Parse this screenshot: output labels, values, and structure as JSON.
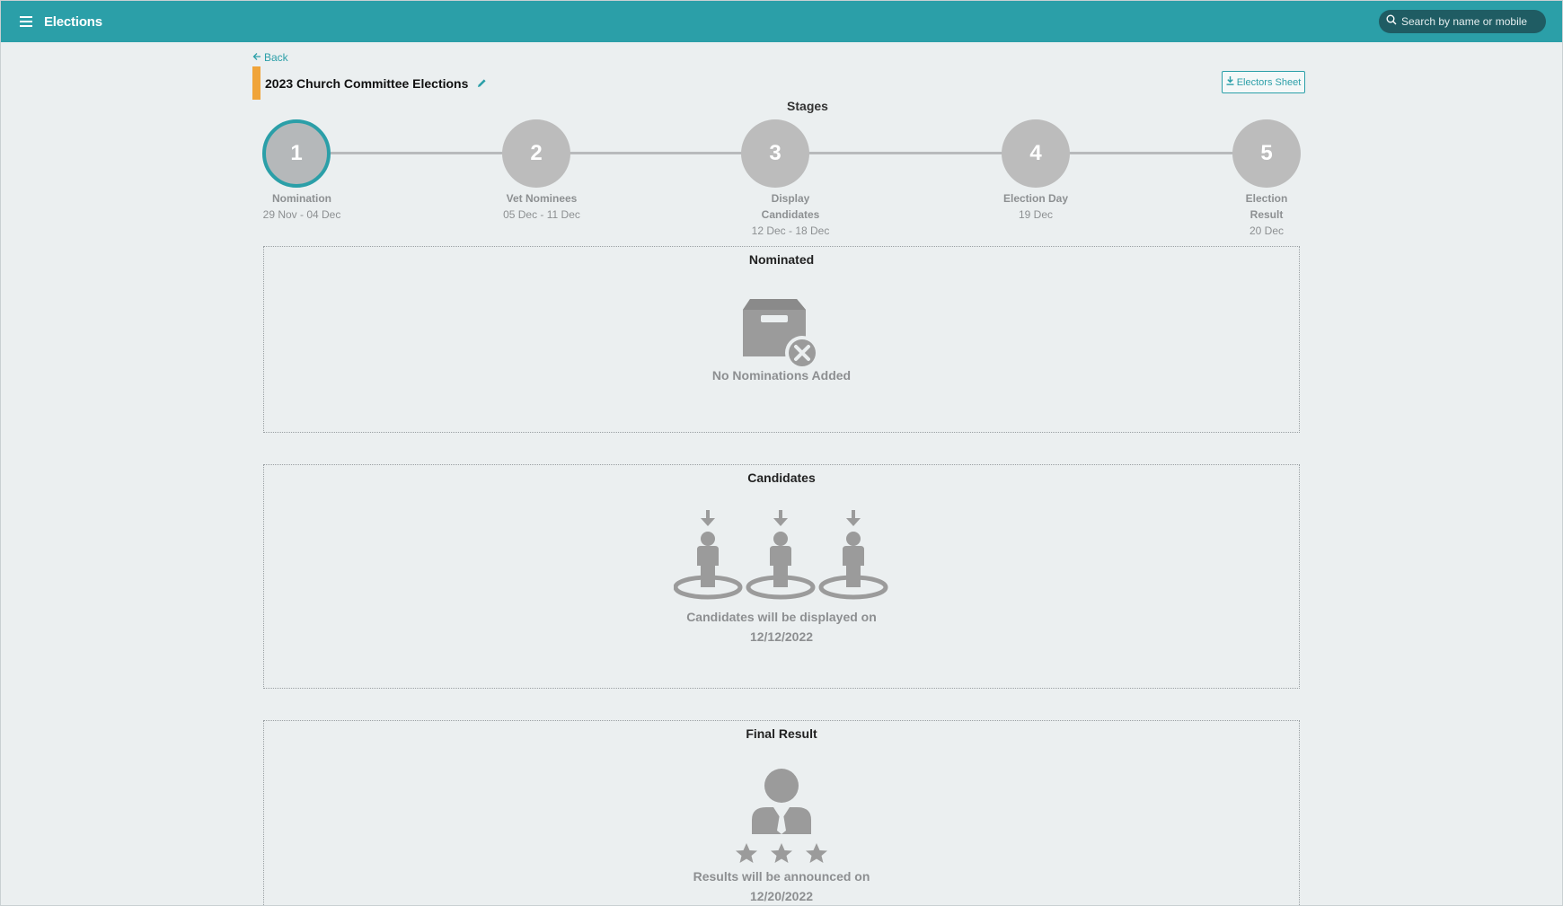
{
  "topbar": {
    "title": "Elections",
    "search_placeholder": "Search by name or mobile",
    "icons": [
      "menu-icon",
      "search-icon"
    ]
  },
  "header": {
    "back_label": "Back",
    "title": "2023 Church Committee Elections",
    "electors_button": "Electors Sheet",
    "accent_color": "#f0a43a"
  },
  "stages": {
    "title": "Stages",
    "current": 1,
    "items": [
      {
        "number": "1",
        "label": "Nomination",
        "label2": "",
        "date": "29 Nov - 04 Dec"
      },
      {
        "number": "2",
        "label": "Vet Nominees",
        "label2": "",
        "date": "05 Dec - 11 Dec"
      },
      {
        "number": "3",
        "label": "Display Candidates",
        "label2": "",
        "date": "12 Dec - 18 Dec"
      },
      {
        "number": "4",
        "label": "Election Day",
        "label2": "",
        "date": "19 Dec"
      },
      {
        "number": "5",
        "label": "Election",
        "label2": "Result",
        "date": "20 Dec"
      }
    ]
  },
  "panels": {
    "nominated": {
      "title": "Nominated",
      "message": "No Nominations Added",
      "icon": "empty-box-icon"
    },
    "candidates": {
      "title": "Candidates",
      "message_line1": "Candidates will be displayed on",
      "message_line2": "12/12/2022",
      "icon": "candidates-icon"
    },
    "final": {
      "title": "Final Result",
      "message_line1": "Results will be announced on",
      "message_line2": "12/20/2022",
      "icon": "winner-icon"
    }
  },
  "colors": {
    "brand": "#2b9fa8",
    "background": "#ebeff0",
    "step_inactive": "#bcbcbc"
  }
}
